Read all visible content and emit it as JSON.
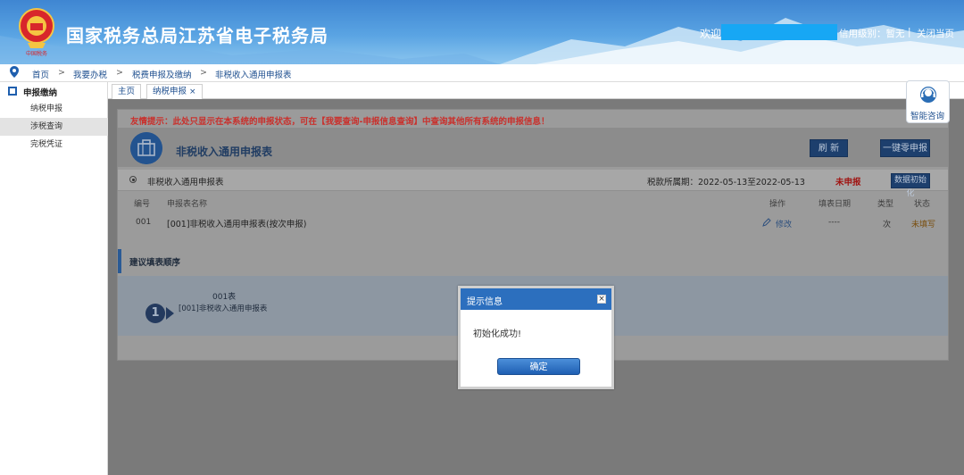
{
  "header": {
    "site_title": "国家税务总局江苏省电子税务局",
    "welcome": "欢迎",
    "credit_level": "信用级别：暂无",
    "separator": "|",
    "close_page": "关闭当页"
  },
  "breadcrumb": {
    "items": [
      "首页",
      "我要办税",
      "税费申报及缴纳",
      "非税收入通用申报表"
    ],
    "arrow": ">"
  },
  "sidebar": {
    "section": "申报缴纳",
    "items": [
      "纳税申报",
      "涉税查询",
      "完税凭证"
    ]
  },
  "tabs": [
    {
      "label": "主页"
    },
    {
      "label": "纳税申报",
      "close": "×"
    }
  ],
  "consult": {
    "label": "智能咨询"
  },
  "main": {
    "notice": "友情提示：此处只显示在本系统的申报状态，可在【我要查询-申报信息查询】中查询其他所有系统的申报信息！",
    "form_title": "非税收入通用申报表",
    "refresh_button": "刷 新",
    "zero_declare_button": "一键零申报",
    "report_row": {
      "name": "非税收入通用申报表",
      "period": "税款所属期：2022-05-13至2022-05-13",
      "status": "未申报",
      "init_button": "数据初始化"
    },
    "table": {
      "headers": {
        "no": "编号",
        "name": "申报表名称",
        "op": "操作",
        "date": "填表日期",
        "type": "类型",
        "state": "状态"
      },
      "rows": [
        {
          "no": "001",
          "name": "[001]非税收入通用申报表(按次申报)",
          "op": "修改",
          "date": "----",
          "type": "次",
          "state": "未填写"
        }
      ]
    },
    "suggest_title": "建议填表顺序",
    "steps": [
      {
        "number": "1",
        "line1": "001表",
        "line2": "[001]非税收入通用申报表"
      }
    ]
  },
  "dialog": {
    "title": "提示信息",
    "close": "×",
    "message": "初始化成功!",
    "ok": "确定"
  },
  "colors": {
    "header_blue": "#3f86d2",
    "notice_red": "#c9302c",
    "dialog_blue": "#2c6fbe",
    "link_blue": "#1e4f8f"
  }
}
